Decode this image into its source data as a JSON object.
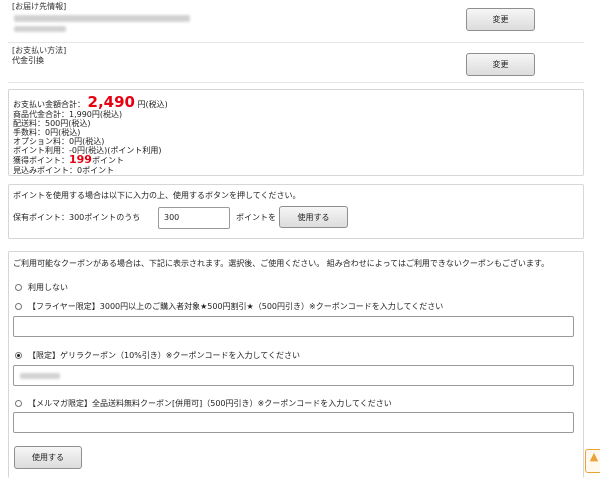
{
  "delivery": {
    "heading": "[お届け先情報]",
    "change_label": "変更"
  },
  "payment": {
    "heading": "[お支払い方法]",
    "method": "代金引換",
    "change_label": "変更"
  },
  "totals": {
    "total_label": "お支払い金額合計：",
    "total_amount": "2,490",
    "total_unit": "円(税込)",
    "lines": [
      "商品代金合計：1,990円(税込)",
      "配送料：500円(税込)",
      "手数料：0円(税込)",
      "オプション料：0円(税込)",
      "ポイント利用：-0円(税込)(ポイント利用)"
    ],
    "earned_label": "獲得ポイント：",
    "earned_value": "199",
    "earned_unit": "ポイント",
    "estimated": "見込みポイント：0ポイント"
  },
  "points": {
    "instruction": "ポイントを使用する場合は以下に入力の上、使用するボタンを押してください。",
    "held_label": "保有ポイント：300ポイントのうち",
    "input_value": "300",
    "suffix": "ポイントを",
    "use_button": "使用する"
  },
  "coupons": {
    "notice": "ご利用可能なクーポンがある場合は、下記に表示されます。選択後、ご使用ください。 組み合わせによってはご利用できないクーポンもございます。",
    "options": [
      {
        "label": "利用しない",
        "checked": false
      },
      {
        "label": "【フライヤー限定】3000円以上のご購入者対象★500円割引★（500円引き）※クーポンコードを入力してください",
        "checked": false
      },
      {
        "label": "【限定】ゲリラクーポン（10%引き）※クーポンコードを入力してください",
        "checked": true
      },
      {
        "label": "【メルマガ限定】全品送料無料クーポン[併用可]（500円引き）※クーポンコードを入力してください",
        "checked": false
      }
    ],
    "use_button": "使用する"
  },
  "scroll_top_icon": "arrow-up-icon"
}
